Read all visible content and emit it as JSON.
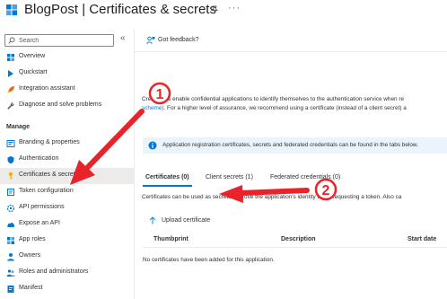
{
  "header": {
    "title": "BlogPost | Certificates & secrets"
  },
  "sidebar": {
    "search_placeholder": "Search",
    "collapse_glyph": "«",
    "items": [
      {
        "label": "Overview",
        "icon": "overview-icon"
      },
      {
        "label": "Quickstart",
        "icon": "quickstart-icon"
      },
      {
        "label": "Integration assistant",
        "icon": "rocket-icon"
      },
      {
        "label": "Diagnose and solve problems",
        "icon": "wrench-icon"
      }
    ],
    "manage_title": "Manage",
    "manage_items": [
      {
        "label": "Branding & properties",
        "icon": "branding-icon"
      },
      {
        "label": "Authentication",
        "icon": "authentication-icon"
      },
      {
        "label": "Certificates & secrets",
        "icon": "key-icon",
        "selected": true
      },
      {
        "label": "Token configuration",
        "icon": "token-icon"
      },
      {
        "label": "API permissions",
        "icon": "api-permissions-icon"
      },
      {
        "label": "Expose an API",
        "icon": "cloud-icon"
      },
      {
        "label": "App roles",
        "icon": "app-roles-icon"
      },
      {
        "label": "Owners",
        "icon": "owners-icon"
      },
      {
        "label": "Roles and administrators",
        "icon": "roles-icon"
      },
      {
        "label": "Manifest",
        "icon": "manifest-icon"
      }
    ]
  },
  "main": {
    "feedback": "Got feedback?",
    "intro_line1": "Credentials enable confidential applications to identify themselves to the authentication service when re",
    "intro_line2_link": "scheme).",
    "intro_line2_rest": " For a higher level of assurance, we recommend using a certificate (instead of a client secret) a",
    "info_text": "Application registration certificates, secrets and federated credentials can be found in the tabs below.",
    "tabs": [
      {
        "label": "Certificates (0)",
        "active": true
      },
      {
        "label": "Client secrets (1)",
        "active": false
      },
      {
        "label": "Federated credentials (0)",
        "active": false
      }
    ],
    "tab_description": "Certificates can be used as secrets to prove the application's identity when requesting a token. Also ca",
    "upload_label": "Upload certificate",
    "columns": [
      "Thumbprint",
      "Description",
      "Start date"
    ],
    "empty_message": "No certificates have been added for this application."
  },
  "annotations": {
    "marker1": "1",
    "marker2": "2",
    "color": "#e8242a"
  },
  "colors": {
    "accent": "#0078d4",
    "selected_bg": "#edebe9",
    "info_bg": "#ebf3fc"
  }
}
